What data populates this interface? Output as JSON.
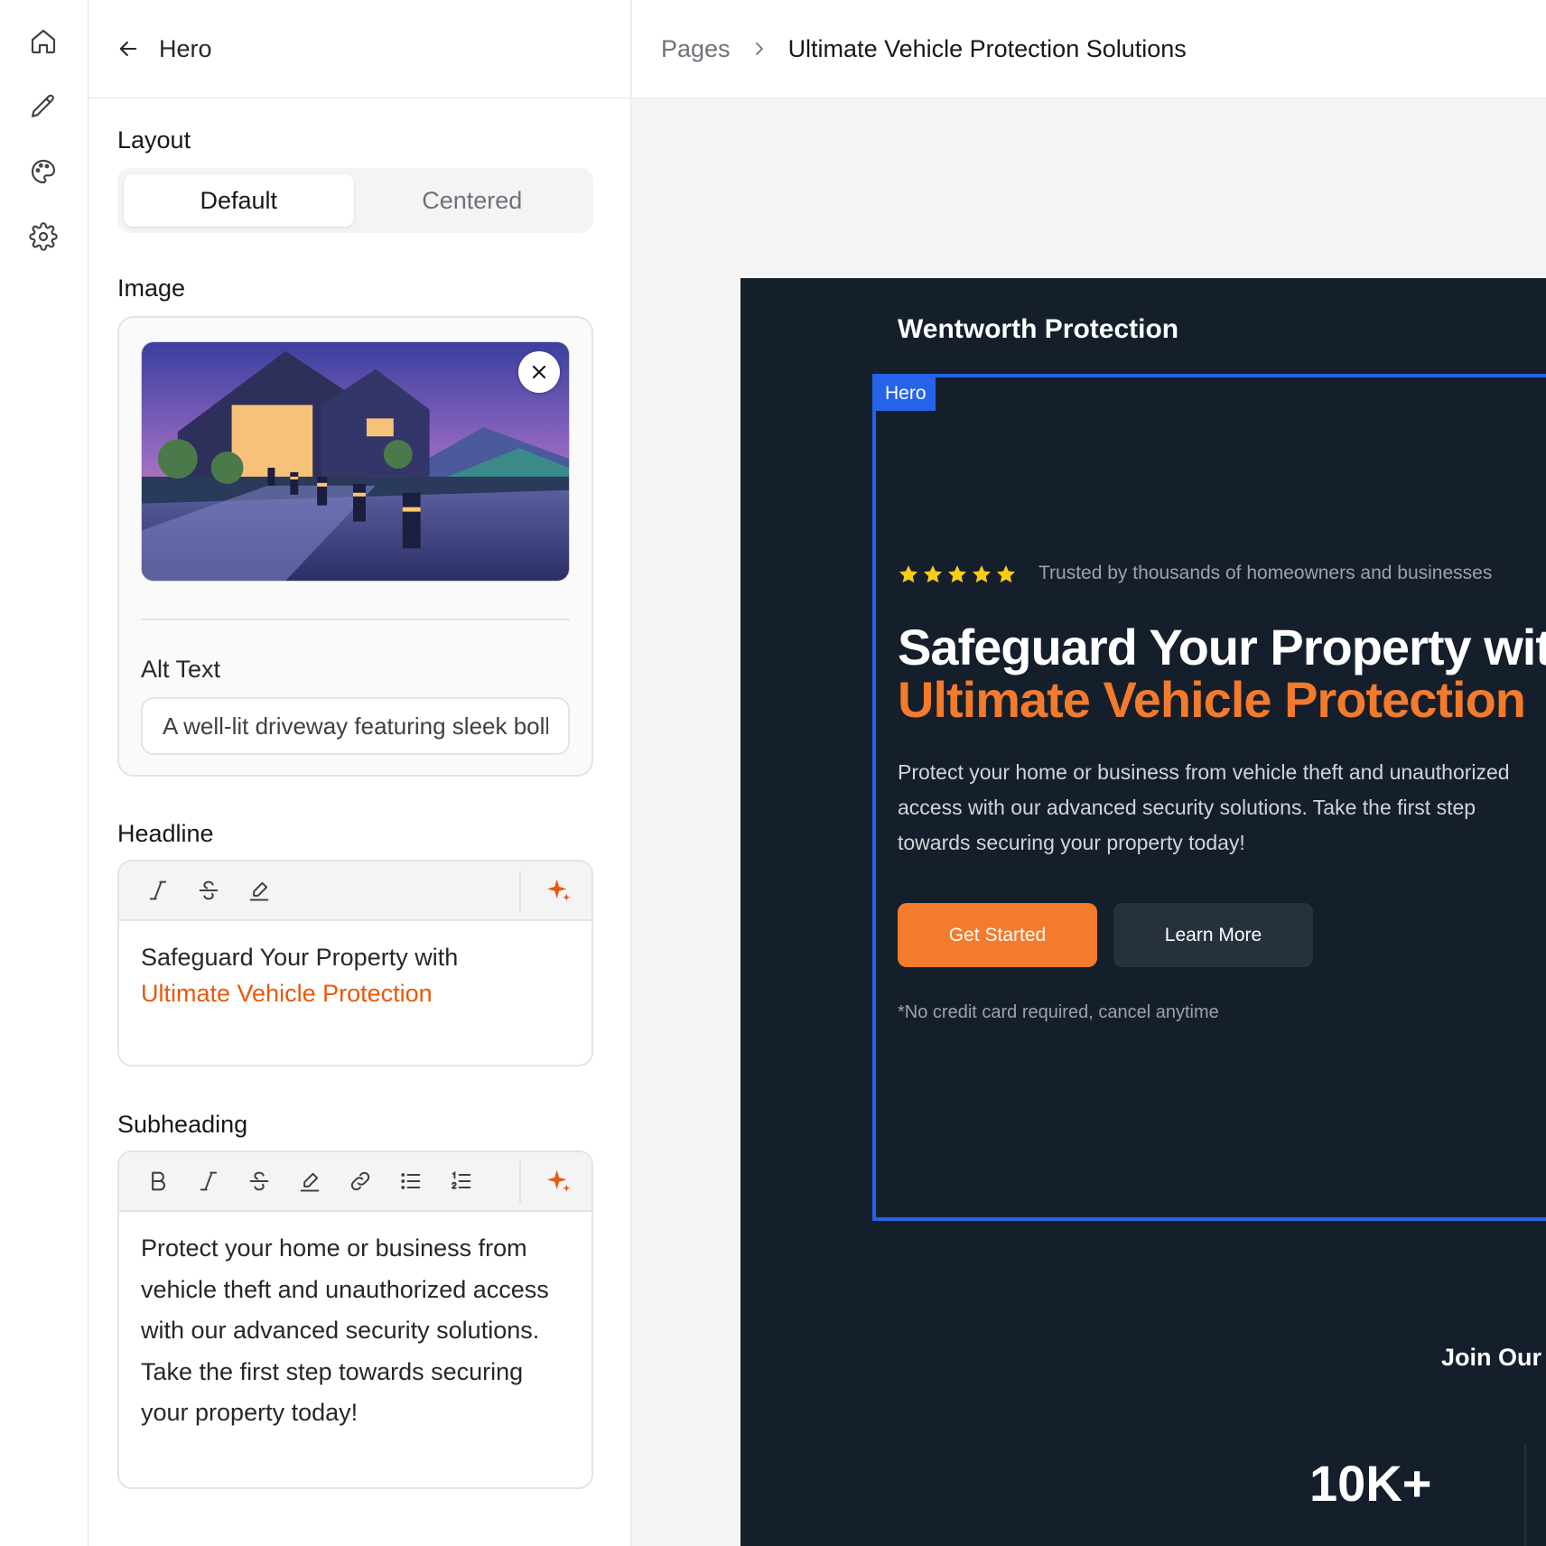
{
  "rail": {
    "items": [
      {
        "icon": "home-icon"
      },
      {
        "icon": "pencil-icon"
      },
      {
        "icon": "palette-icon"
      },
      {
        "icon": "gear-icon"
      }
    ]
  },
  "panel": {
    "title": "Hero",
    "layout": {
      "label": "Layout",
      "options": [
        "Default",
        "Centered"
      ],
      "selected": "Default"
    },
    "image": {
      "label": "Image",
      "alt_label": "Alt Text",
      "alt_value": "A well-lit driveway featuring sleek bollards"
    },
    "headline": {
      "label": "Headline",
      "line1": "Safeguard Your Property with",
      "line2": "Ultimate Vehicle Protection"
    },
    "subheading": {
      "label": "Subheading",
      "text": "Protect your home or business from vehicle theft and unauthorized access with our advanced security solutions. Take the first step towards securing your property today!"
    }
  },
  "breadcrumb": {
    "pages": "Pages",
    "current": "Ultimate Vehicle Protection Solutions"
  },
  "preview": {
    "brand": "Wentworth Protection",
    "hero_tag": "Hero",
    "rating_stars": 5,
    "trusted": "Trusted by thousands of homeowners and businesses",
    "headline_line1": "Safeguard Your Property with",
    "headline_line2": "Ultimate Vehicle Protection",
    "subheading": "Protect your home or business from vehicle theft and unauthorized access with our advanced security solutions. Take the first step towards securing your property today!",
    "primary_cta": "Get Started",
    "secondary_cta": "Learn More",
    "fineprint": "*No credit card required, cancel anytime",
    "join_text": "Join Our",
    "stat_value": "10K+"
  },
  "colors": {
    "accent_orange": "#f47a2c",
    "selection_blue": "#2563eb",
    "preview_bg": "#151f2c"
  }
}
